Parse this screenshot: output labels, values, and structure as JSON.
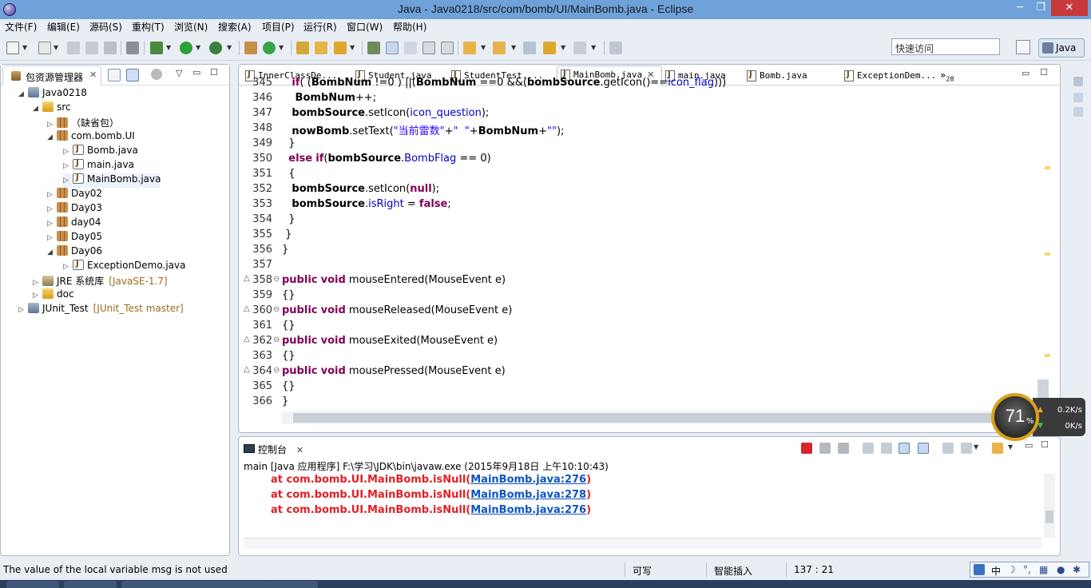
{
  "window": {
    "title": "Java - Java0218/src/com/bomb/UI/MainBomb.java - Eclipse",
    "min": "─",
    "max": "❐",
    "close": "✕"
  },
  "menu": [
    "文件(F)",
    "编辑(E)",
    "源码(S)",
    "重构(T)",
    "浏览(N)",
    "搜索(A)",
    "项目(P)",
    "运行(R)",
    "窗口(W)",
    "帮助(H)"
  ],
  "toolbar": {
    "quick_access_placeholder": "快速访问",
    "perspective_label": "Java"
  },
  "package_explorer": {
    "tab_label": "包资源管理器",
    "close": "✕",
    "tree": [
      {
        "label": "Java0218",
        "icon": "project-icon",
        "expanded": true
      },
      {
        "label": "src",
        "icon": "folder-icon",
        "expanded": true
      },
      {
        "label": "（缺省包）",
        "icon": "package-icon",
        "expanded": false
      },
      {
        "label": "com.bomb.UI",
        "icon": "package-icon",
        "expanded": true
      },
      {
        "label": "Bomb.java",
        "icon": "java-file-icon"
      },
      {
        "label": "main.java",
        "icon": "java-file-icon"
      },
      {
        "label": "MainBomb.java",
        "icon": "java-file-icon",
        "selected": true
      },
      {
        "label": "Day02",
        "icon": "package-icon"
      },
      {
        "label": "Day03",
        "icon": "package-icon"
      },
      {
        "label": "day04",
        "icon": "package-icon"
      },
      {
        "label": "Day05",
        "icon": "package-icon"
      },
      {
        "label": "Day06",
        "icon": "package-icon",
        "expanded": true
      },
      {
        "label": "ExceptionDemo.java",
        "icon": "java-file-icon"
      },
      {
        "label": "JRE 系统库",
        "extra": "[JavaSE-1.7]",
        "icon": "library-icon"
      },
      {
        "label": "doc",
        "icon": "folder-icon"
      },
      {
        "label": "JUnit_Test",
        "extra": "[JUnit_Test master]",
        "icon": "project-icon"
      }
    ]
  },
  "editor": {
    "tabs": [
      {
        "label": "InnerClassDe...",
        "active": false
      },
      {
        "label": "Student.java",
        "active": false
      },
      {
        "label": "StudentTest....",
        "active": false
      },
      {
        "label": "MainBomb.java",
        "active": true,
        "close": "✕"
      },
      {
        "label": "main.java",
        "active": false
      },
      {
        "label": "Bomb.java",
        "active": false
      },
      {
        "label": "ExceptionDem...",
        "active": false
      }
    ],
    "tab_overflow": "»",
    "tab_overflow_count": "28",
    "code": [
      {
        "ln": "345",
        "text": "   if( (BombNum !=0 ) ||(BombNum ==0 &&(bombSource.getIcon()==icon_flag)))"
      },
      {
        "ln": "346",
        "text": "    BombNum++;"
      },
      {
        "ln": "347",
        "text": "   bombSource.setIcon(icon_question);"
      },
      {
        "ln": "348",
        "text": "   nowBomb.setText(\"当前雷数\"+\"  \"+BombNum+\"\");"
      },
      {
        "ln": "349",
        "text": "  }"
      },
      {
        "ln": "350",
        "text": "  else if(bombSource.BombFlag == 0)"
      },
      {
        "ln": "351",
        "text": "  {"
      },
      {
        "ln": "352",
        "text": "   bombSource.setIcon(null);"
      },
      {
        "ln": "353",
        "text": "   bombSource.isRight = false;"
      },
      {
        "ln": "354",
        "text": "  }"
      },
      {
        "ln": "355",
        "text": " }"
      },
      {
        "ln": "356",
        "text": "}"
      },
      {
        "ln": "357",
        "text": ""
      },
      {
        "ln": "358",
        "text": "public void mouseEntered(MouseEvent e)"
      },
      {
        "ln": "359",
        "text": "{}"
      },
      {
        "ln": "360",
        "text": "public void mouseReleased(MouseEvent e)"
      },
      {
        "ln": "361",
        "text": "{}"
      },
      {
        "ln": "362",
        "text": "public void mouseExited(MouseEvent e)"
      },
      {
        "ln": "363",
        "text": "{}"
      },
      {
        "ln": "364",
        "text": "public void mousePressed(MouseEvent e)"
      },
      {
        "ln": "365",
        "text": "{}"
      },
      {
        "ln": "366",
        "text": "}"
      }
    ]
  },
  "console": {
    "tab_label": "控制台",
    "close": "✕",
    "description": "main [Java 应用程序] F:\\学习\\JDK\\bin\\javaw.exe (2015年9月18日 上午10:10:43)",
    "lines": [
      {
        "prefix": "at com.bomb.UI.MainBomb.isNull(",
        "link": "MainBomb.java:276",
        "suffix": ")"
      },
      {
        "prefix": "at com.bomb.UI.MainBomb.isNull(",
        "link": "MainBomb.java:278",
        "suffix": ")"
      },
      {
        "prefix": "at com.bomb.UI.MainBomb.isNull(",
        "link": "MainBomb.java:276",
        "suffix": ")"
      }
    ]
  },
  "status": {
    "message": "The value of the local variable msg is not used",
    "writable": "可写",
    "insert_mode": "智能插入",
    "position": "137 : 21"
  },
  "ime": {
    "mode": "中"
  },
  "net_widget": {
    "percent": "71",
    "pct_sign": "%",
    "up": "0.2K/s",
    "down": "0K/s"
  },
  "colors": {
    "titlebar": "#6fa2da",
    "keyword": "#7f0055",
    "field": "#0000c0",
    "string": "#2a00ff",
    "error": "#e21f25",
    "link": "#0e55c2"
  }
}
